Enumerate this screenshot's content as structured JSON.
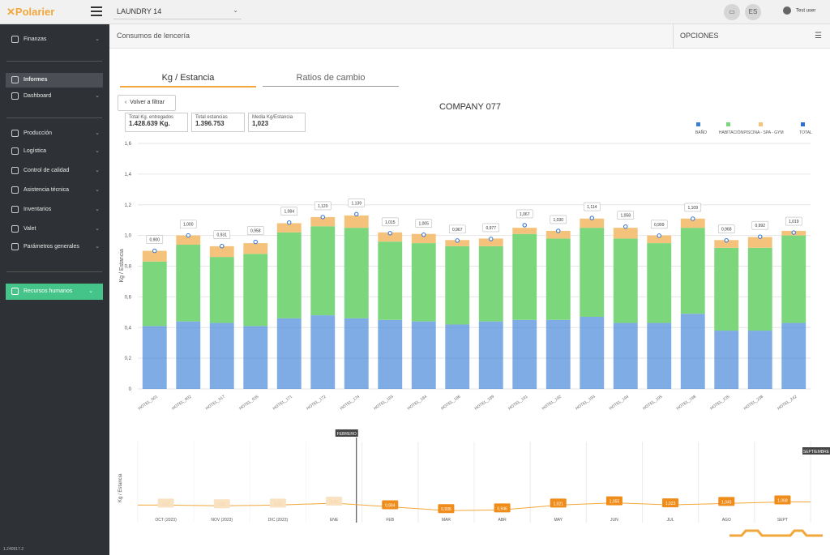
{
  "topbar": {
    "logo": "Polarier",
    "site": "LAUNDRY 14",
    "lang": "ES",
    "user": "Test user"
  },
  "sidebar": {
    "items": [
      {
        "label": "Finanzas",
        "icon": "euro-icon"
      },
      {
        "label": "Informes",
        "icon": "chart-icon"
      },
      {
        "label": "Dashboard",
        "icon": "monitor-icon"
      },
      {
        "label": "Producción",
        "icon": "factory-icon"
      },
      {
        "label": "Logística",
        "icon": "truck-icon"
      },
      {
        "label": "Control de calidad",
        "icon": "check-circle-icon"
      },
      {
        "label": "Asistencia técnica",
        "icon": "wrench-icon"
      },
      {
        "label": "Inventarios",
        "icon": "list-icon"
      },
      {
        "label": "Valet",
        "icon": "shirt-icon"
      },
      {
        "label": "Parámetros generales",
        "icon": "sliders-icon"
      },
      {
        "label": "Recursos humanos",
        "icon": "people-icon"
      }
    ],
    "version": "1.240917.2"
  },
  "subheader": {
    "title": "Consumos de lencería",
    "options": "OPCIONES"
  },
  "tabs": [
    "Kg / Estancia",
    "Ratios de cambio"
  ],
  "back_button": "Volver a filtrar",
  "stats": [
    {
      "label": "Total Kg. entregados",
      "value": "1.428.639 Kg."
    },
    {
      "label": "Total estancias",
      "value": "1.396.753"
    },
    {
      "label": "Media Kg/Estancia",
      "value": "1,023"
    }
  ],
  "company": "COMPANY 077",
  "colors": {
    "bano": "#3a7fd5",
    "habitacion": "#7cd67c",
    "piscina": "#f4c27a",
    "total": "#2f6fd1"
  },
  "chart_data": [
    {
      "type": "bar",
      "stacked": true,
      "ylabel": "Kg / Estancia",
      "ylim": [
        0,
        1.6
      ],
      "yticks": [
        "0",
        "0,2",
        "0,4",
        "0,6",
        "0,8",
        "1,0",
        "1,2",
        "1,4",
        "1,6"
      ],
      "legend": [
        "BAÑO",
        "HABITACIÓN",
        "PISCINA - SPA - GYM",
        "TOTAL"
      ],
      "legend_position": "top-right",
      "categories": [
        "HOTEL_001",
        "HOTEL_002",
        "HOTEL_017",
        "HOTEL_035",
        "HOTEL_171",
        "HOTEL_172",
        "HOTEL_174",
        "HOTEL_183",
        "HOTEL_184",
        "HOTEL_186",
        "HOTEL_189",
        "HOTEL_191",
        "HOTEL_192",
        "HOTEL_193",
        "HOTEL_194",
        "HOTEL_195",
        "HOTEL_198",
        "HOTEL_235",
        "HOTEL_238",
        "HOTEL_242"
      ],
      "series": [
        {
          "name": "BAÑO",
          "values": [
            0.41,
            0.44,
            0.43,
            0.41,
            0.46,
            0.48,
            0.46,
            0.45,
            0.44,
            0.42,
            0.44,
            0.45,
            0.45,
            0.47,
            0.43,
            0.43,
            0.49,
            0.38,
            0.38,
            0.43
          ]
        },
        {
          "name": "HABITACIÓN",
          "values": [
            0.42,
            0.5,
            0.43,
            0.47,
            0.56,
            0.58,
            0.59,
            0.51,
            0.51,
            0.51,
            0.49,
            0.56,
            0.53,
            0.58,
            0.55,
            0.52,
            0.56,
            0.54,
            0.54,
            0.57
          ]
        },
        {
          "name": "PISCINA - SPA - GYM",
          "values": [
            0.07,
            0.06,
            0.07,
            0.07,
            0.06,
            0.06,
            0.08,
            0.06,
            0.06,
            0.04,
            0.05,
            0.04,
            0.05,
            0.06,
            0.07,
            0.05,
            0.06,
            0.05,
            0.07,
            0.03
          ]
        }
      ],
      "totals": [
        0.9,
        1.0,
        0.931,
        0.958,
        1.084,
        1.12,
        1.139,
        1.015,
        1.005,
        0.967,
        0.977,
        1.067,
        1.03,
        1.114,
        1.058,
        0.999,
        1.109,
        0.968,
        0.992,
        1.019
      ],
      "total_labels": [
        "0,900",
        "1,000",
        "0,931",
        "0,958",
        "1,084",
        "1,120",
        "1,139",
        "1,015",
        "1,005",
        "0,967",
        "0,977",
        "1,067",
        "1,030",
        "1,114",
        "1,058",
        "0,999",
        "1,109",
        "0,968",
        "0,992",
        "1,019"
      ]
    },
    {
      "type": "line",
      "ylabel": "Kg / Estancia",
      "categories": [
        "OCT (2023)",
        "NOV (2023)",
        "DIC (2023)",
        "ENE",
        "FEB",
        "MAR",
        "ABR",
        "MAY",
        "JUN",
        "JUL",
        "AGO",
        "SEPT"
      ],
      "values": [
        1.02,
        1.01,
        1.02,
        1.05,
        0.994,
        0.935,
        0.946,
        1.021,
        1.055,
        1.023,
        1.045,
        1.068
      ],
      "labels": [
        "1,02",
        "1,01",
        "1,02",
        "1,05",
        "0,994",
        "0,935",
        "0,946",
        "1,021",
        "1,055",
        "1,023",
        "1,045",
        "1,068"
      ],
      "range_start_label": "FEBRERO",
      "range_end_label": "SEPTIEMBRE"
    }
  ]
}
